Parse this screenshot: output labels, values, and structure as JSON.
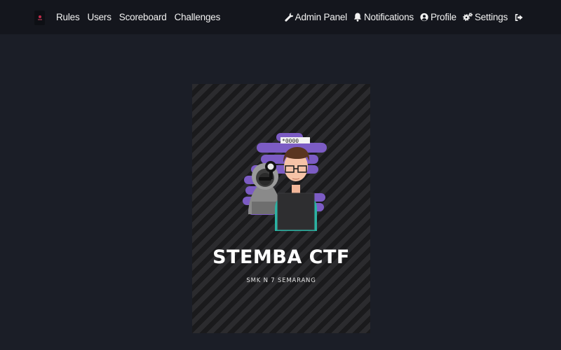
{
  "nav": {
    "left_links": [
      {
        "label": "Rules"
      },
      {
        "label": "Users"
      },
      {
        "label": "Scoreboard"
      },
      {
        "label": "Challenges"
      }
    ],
    "right_links": [
      {
        "label": "Admin Panel",
        "icon": "wrench-icon"
      },
      {
        "label": "Notifications",
        "icon": "bell-icon"
      },
      {
        "label": "Profile",
        "icon": "user-circle-icon"
      },
      {
        "label": "Settings",
        "icon": "gears-icon"
      }
    ],
    "logout_icon": "sign-out-icon"
  },
  "banner": {
    "title": "STEMBA CTF",
    "subtitle": "SMK N 7 SEMARANG",
    "password_field_text": "*0000"
  },
  "colors": {
    "background": "#1b1e27",
    "navbar": "#14161d",
    "accent_purple": "#7c5cc4",
    "accent_teal": "#2bb3a3"
  }
}
